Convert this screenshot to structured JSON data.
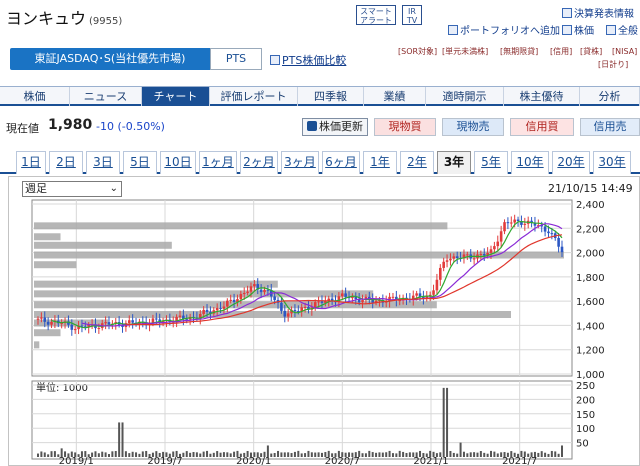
{
  "header": {
    "title": "ヨンキュウ",
    "code": "(9955)",
    "smart_alert": "スマート\nアラート",
    "ir_tv": "IR\nTV",
    "links": [
      "決算発表情報",
      "ポートフォリオへ追加",
      "株価",
      "全般"
    ]
  },
  "market": {
    "selected": "東証JASDAQ･S(当社優先市場)",
    "pts": "PTS",
    "pts_compare": "PTS株価比較"
  },
  "badges": [
    "[SOR対象]",
    "[単元未満株]",
    "[無期限貸]",
    "[信用]",
    "[貸株]",
    "[NISA]",
    "[日計り]"
  ],
  "nav": {
    "tabs": [
      "株価",
      "ニュース",
      "チャート",
      "評価レポート",
      "四季報",
      "業績",
      "適時開示",
      "株主優待",
      "分析"
    ],
    "active": "チャート"
  },
  "quote": {
    "label": "現在値",
    "price": "1,980",
    "change": "-10 (-0.50%)"
  },
  "actions": {
    "refresh": "株価更新",
    "spot_buy": "現物買",
    "spot_sell": "現物売",
    "credit_buy": "信用買",
    "credit_sell": "信用売"
  },
  "periods": {
    "items": [
      "1日",
      "2日",
      "3日",
      "5日",
      "10日",
      "1ヶ月",
      "2ヶ月",
      "3ヶ月",
      "6ヶ月",
      "1年",
      "2年",
      "3年",
      "5年",
      "10年",
      "20年",
      "30年"
    ],
    "active": "3年"
  },
  "chart_controls": {
    "interval": "週足",
    "timestamp": "21/10/15 14:49",
    "volume_unit": "単位: 1000"
  },
  "chart_data": [
    {
      "type": "candlestick",
      "interval": "週足",
      "x": [
        "2018/10",
        "2018/12",
        "2019/1",
        "2019/3",
        "2019/5",
        "2019/7",
        "2019/9",
        "2019/11",
        "2020/1",
        "2020/2",
        "2020/3",
        "2020/4",
        "2020/5",
        "2020/7",
        "2020/9",
        "2020/11",
        "2021/1",
        "2021/2",
        "2021/3",
        "2021/5",
        "2021/6",
        "2021/7",
        "2021/8",
        "2021/9",
        "2021/10"
      ],
      "close": [
        1450,
        1420,
        1380,
        1410,
        1420,
        1440,
        1470,
        1560,
        1720,
        1680,
        1500,
        1520,
        1570,
        1640,
        1600,
        1620,
        1650,
        1960,
        1960,
        1990,
        2240,
        2260,
        2230,
        2180,
        1980
      ],
      "ylim": [
        1000,
        2400
      ],
      "yticks": [
        "1,000",
        "1,200",
        "1,400",
        "1,600",
        "1,800",
        "2,000",
        "2,200",
        "2,400"
      ],
      "xticks": [
        "2019/1",
        "2019/7",
        "2020/1",
        "2020/7",
        "2021/1",
        "2021/7"
      ],
      "volume_by_price": [
        {
          "price": 2220,
          "level": 0.78
        },
        {
          "price": 2130,
          "level": 0.05
        },
        {
          "price": 2060,
          "level": 0.26
        },
        {
          "price": 1980,
          "level": 1.0
        },
        {
          "price": 1900,
          "level": 0.08
        },
        {
          "price": 1740,
          "level": 0.46
        },
        {
          "price": 1660,
          "level": 0.64
        },
        {
          "price": 1570,
          "level": 0.76
        },
        {
          "price": 1490,
          "level": 0.9
        },
        {
          "price": 1420,
          "level": 0.14
        },
        {
          "price": 1340,
          "level": 0.05
        },
        {
          "price": 1240,
          "level": 0.01
        }
      ]
    },
    {
      "type": "bar",
      "title": "単位: 1000",
      "ylim": [
        0,
        250
      ],
      "yticks": [
        "50",
        "100",
        "150",
        "200",
        "250"
      ],
      "volume_peaks": [
        {
          "date": "2018/12",
          "value": 30
        },
        {
          "date": "2019/4",
          "value": 120
        },
        {
          "date": "2020/2",
          "value": 40
        },
        {
          "date": "2021/2",
          "value": 240
        },
        {
          "date": "2021/3",
          "value": 50
        },
        {
          "date": "2021/10",
          "value": 40
        }
      ]
    }
  ],
  "colors": {
    "accent": "#1a4f94",
    "up": "#e23b3b",
    "down": "#2b57c4",
    "ma_short": "#8a2bd6",
    "ma_long": "#e0362c",
    "ma_mid": "#2fa82f"
  }
}
